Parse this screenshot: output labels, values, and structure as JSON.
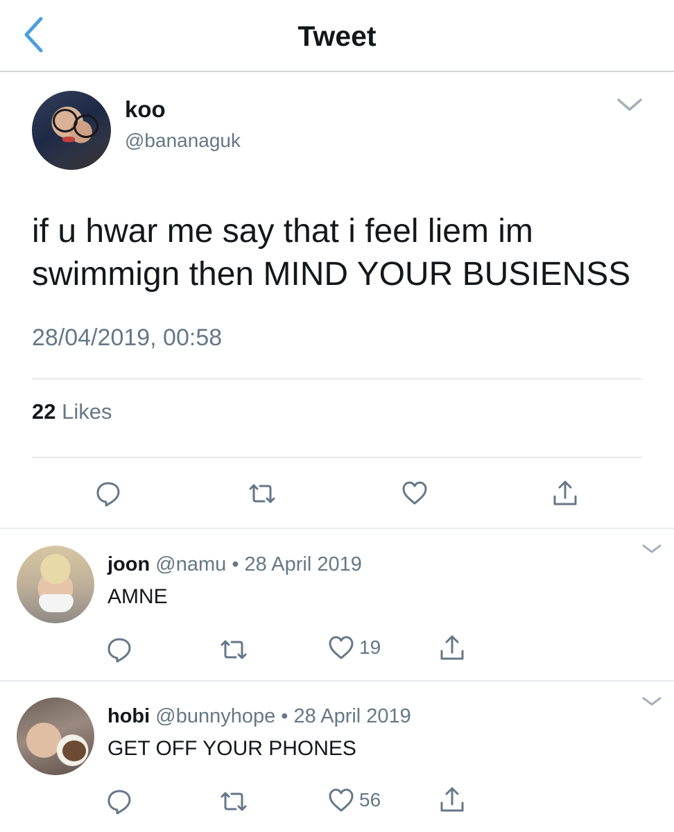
{
  "header": {
    "title": "Tweet",
    "accent_color": "#4a9ee0",
    "back_icon": "chevron-left-icon"
  },
  "main_tweet": {
    "display_name": "koo",
    "handle": "@bananaguk",
    "text": "if u hwar me say that i feel liem  im swimmign then MIND YOUR BUSIENSS",
    "timestamp": "28/04/2019, 00:58",
    "likes_count": "22",
    "likes_label": "Likes",
    "actions": [
      "reply-icon",
      "retweet-icon",
      "like-icon",
      "share-icon"
    ]
  },
  "replies": [
    {
      "display_name": "joon",
      "handle": "@namu",
      "separator": "•",
      "date": "28 April 2019",
      "text": "AMNE",
      "like_count": "19"
    },
    {
      "display_name": "hobi",
      "handle": "@bunnyhope",
      "separator": "•",
      "date": "28 April 2019",
      "text": "GET OFF YOUR PHONES",
      "like_count": "56"
    }
  ],
  "colors": {
    "text_primary": "#14171a",
    "text_secondary": "#657786",
    "divider": "#d3d6d9"
  }
}
